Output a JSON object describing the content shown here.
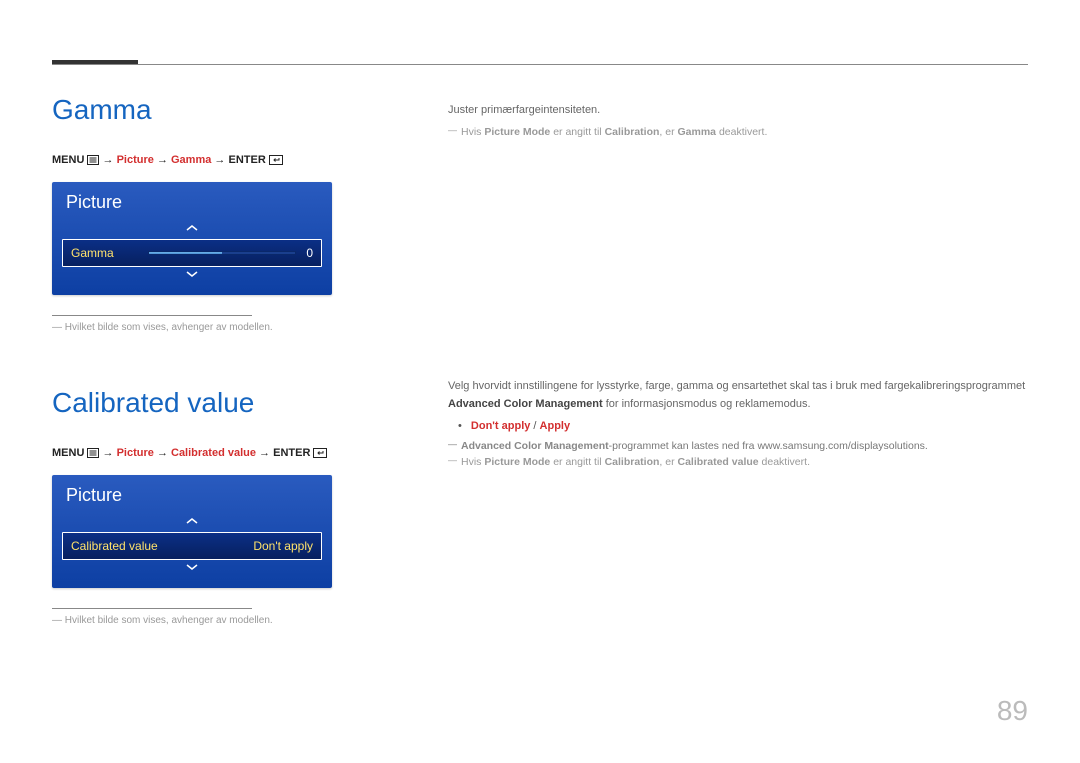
{
  "page_number": "89",
  "gamma": {
    "heading": "Gamma",
    "breadcrumb": {
      "menu": "MENU",
      "arrow": "→",
      "picture": "Picture",
      "item": "Gamma",
      "enter": "ENTER"
    },
    "osd": {
      "title": "Picture",
      "row_label": "Gamma",
      "value": "0"
    },
    "footnote": "Hvilket bilde som vises, avhenger av modellen.",
    "right": {
      "intro": "Juster primærfargeintensiteten.",
      "note_prefix": "Hvis ",
      "note_pm": "Picture Mode",
      "note_mid": " er angitt til ",
      "note_cal": "Calibration",
      "note_mid2": ", er ",
      "note_gamma": "Gamma",
      "note_suffix": " deaktivert."
    }
  },
  "calibrated": {
    "heading": "Calibrated value",
    "breadcrumb": {
      "menu": "MENU",
      "arrow": "→",
      "picture": "Picture",
      "item": "Calibrated value",
      "enter": "ENTER"
    },
    "osd": {
      "title": "Picture",
      "row_label": "Calibrated value",
      "value": "Don't apply"
    },
    "footnote": "Hvilket bilde som vises, avhenger av modellen.",
    "right": {
      "para_a": "Velg hvorvidt innstillingene for lysstyrke, farge, gamma og ensartethet skal tas i bruk med fargekalibreringsprogrammet ",
      "para_b_bold": "Advanced Color Management",
      "para_c": " for informasjonsmodus og reklamemodus.",
      "opt_dont": "Don't apply",
      "opt_sep": " / ",
      "opt_apply": "Apply",
      "dl_prefix_bold": "Advanced Color Management",
      "dl_rest": "-programmet kan lastes ned fra www.samsung.com/displaysolutions.",
      "note_prefix": "Hvis ",
      "note_pm": "Picture Mode",
      "note_mid": " er angitt til ",
      "note_cal": "Calibration",
      "note_mid2": ", er ",
      "note_cv": "Calibrated value",
      "note_suffix": " deaktivert."
    }
  }
}
